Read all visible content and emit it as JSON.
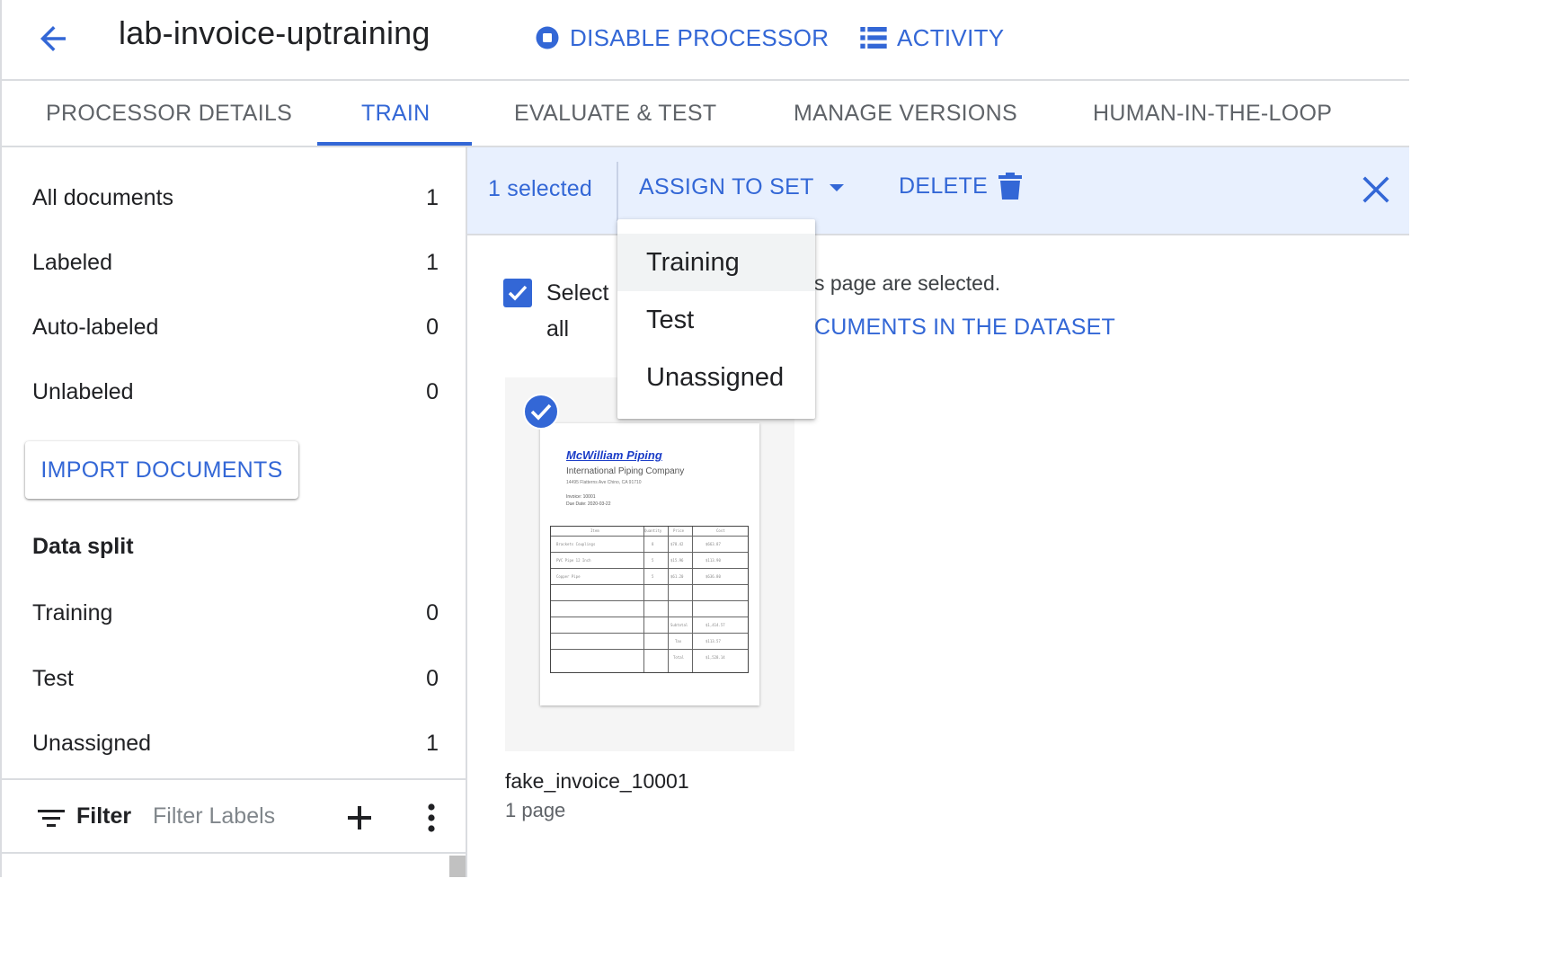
{
  "header": {
    "title": "lab-invoice-uptraining",
    "disable_label": "DISABLE PROCESSOR",
    "activity_label": "ACTIVITY"
  },
  "tabs": [
    {
      "label": "PROCESSOR DETAILS",
      "active": false
    },
    {
      "label": "TRAIN",
      "active": true
    },
    {
      "label": "EVALUATE & TEST",
      "active": false
    },
    {
      "label": "MANAGE VERSIONS",
      "active": false
    },
    {
      "label": "HUMAN-IN-THE-LOOP",
      "active": false
    }
  ],
  "sidebar": {
    "counts": [
      {
        "label": "All documents",
        "count": "1"
      },
      {
        "label": "Labeled",
        "count": "1"
      },
      {
        "label": "Auto-labeled",
        "count": "0"
      },
      {
        "label": "Unlabeled",
        "count": "0"
      }
    ],
    "import_label": "IMPORT DOCUMENTS",
    "data_split_title": "Data split",
    "split": [
      {
        "label": "Training",
        "count": "0"
      },
      {
        "label": "Test",
        "count": "0"
      },
      {
        "label": "Unassigned",
        "count": "1"
      }
    ],
    "filter_label": "Filter",
    "filter_placeholder": "Filter Labels"
  },
  "action_bar": {
    "selected_text": "1 selected",
    "assign_label": "ASSIGN TO SET",
    "delete_label": "DELETE"
  },
  "dropdown": {
    "items": [
      "Training",
      "Test",
      "Unassigned"
    ]
  },
  "selection": {
    "select_all_label": "Select all",
    "page_selected_text": "s page are selected.",
    "select_dataset_link": "CUMENTS IN THE DATASET"
  },
  "document": {
    "name": "fake_invoice_10001",
    "pages": "1 page",
    "preview": {
      "company": "McWilliam Piping",
      "subtitle": "International Piping Company",
      "address": "14495 Flatterns Ave Chino, CA 91710",
      "invoice_line": "Invoice: 10001",
      "due_line": "Due Date: 2020-03-22",
      "headers": [
        "Item",
        "Quantity",
        "Price",
        "Cost"
      ],
      "rows": [
        [
          "Brackets Couplings",
          "8",
          "$78.42",
          "$663.87"
        ],
        [
          "PVC Pipe 12 Inch",
          "5",
          "$15.96",
          "$113.90"
        ],
        [
          "Copper Pipe",
          "5",
          "$61.20",
          "$636.80"
        ]
      ],
      "totals": [
        [
          "Subtotal",
          "$1,414.57"
        ],
        [
          "Tax",
          "$113.57"
        ],
        [
          "Total",
          "$1,528.14"
        ]
      ]
    }
  },
  "colors": {
    "accent": "#3367d6",
    "action_bar_bg": "#e8f0fe"
  }
}
